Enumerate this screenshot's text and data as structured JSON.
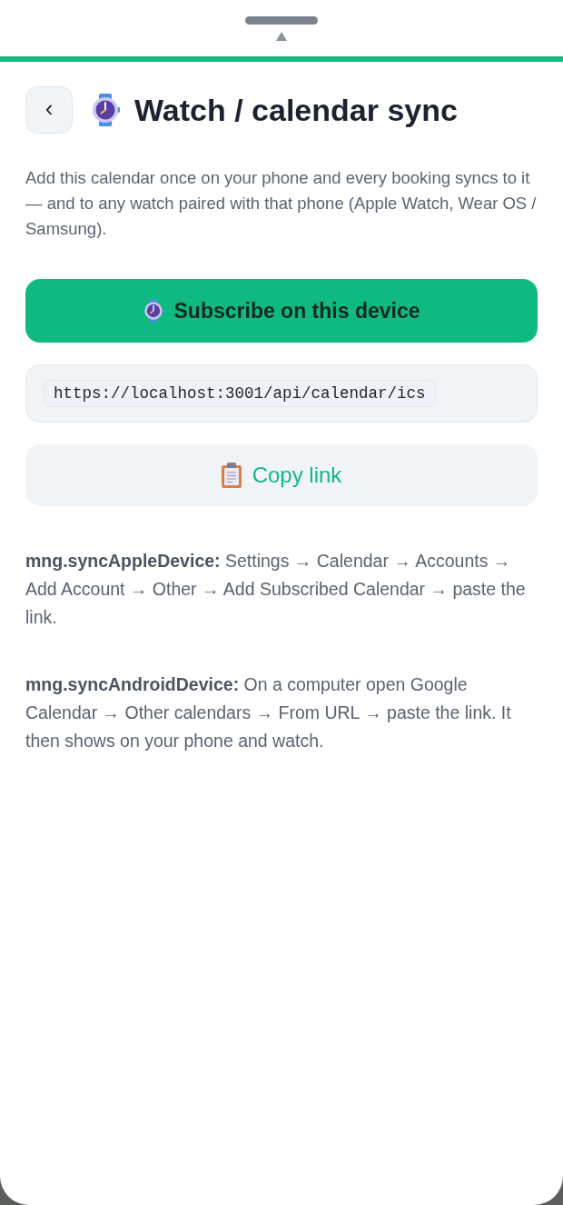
{
  "header": {
    "back_button": {
      "label": "‹"
    },
    "title": "Watch / calendar sync"
  },
  "description": "Add this calendar once on your phone and every booking syncs to it — and to any watch paired with that phone (Apple Watch, Wear OS / Samsung).",
  "subscribe_button": {
    "label": "Subscribe on this device"
  },
  "link": {
    "url": "https://localhost:3001/api/calendar/ics"
  },
  "copy_button": {
    "label": "Copy link"
  },
  "instructions": [
    {
      "text": "**mng.syncAppleDevice:** Settings → Calendar → Accounts → Add Account → Other → Add Subscribed Calendar → paste the link."
    },
    {
      "text": "**mng.syncAndroidDevice:** On a computer open Google Calendar → Other calendars → From URL → paste the link. It then shows on your phone and watch."
    }
  ]
}
